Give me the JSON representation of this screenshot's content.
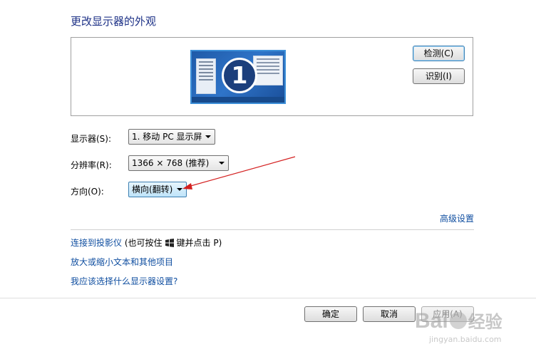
{
  "page": {
    "title": "更改显示器的外观"
  },
  "preview": {
    "monitor_number": "1",
    "detect_label": "检测(C)",
    "identify_label": "识别(I)"
  },
  "settings": {
    "display_label": "显示器(S):",
    "display_value": "1. 移动 PC 显示屏",
    "resolution_label": "分辨率(R):",
    "resolution_value": "1366 × 768 (推荐)",
    "orientation_label": "方向(O):",
    "orientation_value": "横向(翻转)"
  },
  "links": {
    "advanced": "高级设置",
    "projector_link": "连接到投影仪",
    "projector_hint_prefix": "(也可按住",
    "projector_hint_suffix": "键并点击 P)",
    "text_size": "放大或缩小文本和其他项目",
    "which_settings": "我应该选择什么显示器设置?"
  },
  "footer": {
    "ok_label": "确定",
    "cancel_label": "取消",
    "apply_label": "应用(A)"
  },
  "watermark": {
    "brand": "Bai",
    "brand_tail": "经验",
    "url": "jingyan.baidu.com"
  },
  "colors": {
    "title": "#1e3287",
    "link": "#0f4ea0",
    "annotation_arrow": "#d42020"
  }
}
